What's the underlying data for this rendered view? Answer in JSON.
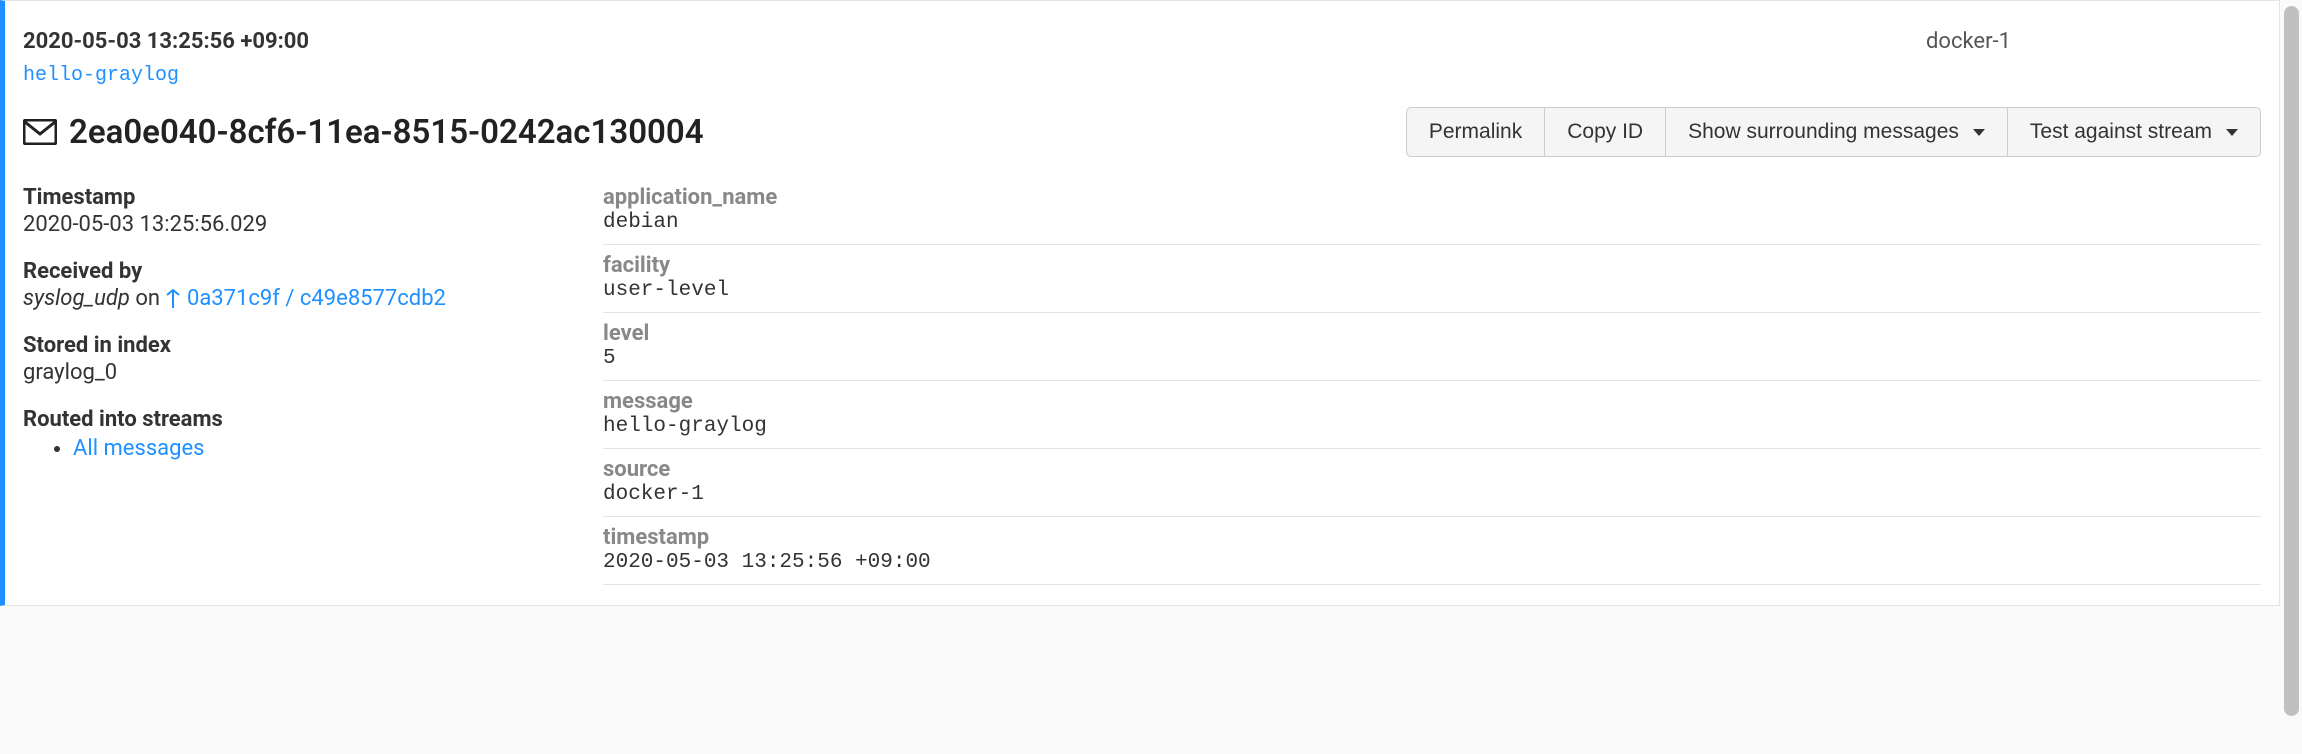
{
  "header": {
    "timestamp": "2020-05-03 13:25:56 +09:00",
    "source": "docker-1",
    "message_preview": "hello-graylog",
    "message_id": "2ea0e040-8cf6-11ea-8515-0242ac130004"
  },
  "buttons": {
    "permalink": "Permalink",
    "copy_id": "Copy ID",
    "surrounding": "Show surrounding messages",
    "test_stream": "Test against stream"
  },
  "meta": {
    "timestamp": {
      "label": "Timestamp",
      "value": "2020-05-03 13:25:56.029"
    },
    "received_by": {
      "label": "Received by",
      "input": "syslog_udp",
      "on": " on ",
      "node": "0a371c9f / c49e8577cdb2"
    },
    "stored_in": {
      "label": "Stored in index",
      "value": "graylog_0"
    },
    "routed": {
      "label": "Routed into streams",
      "streams": [
        "All messages"
      ]
    }
  },
  "fields": [
    {
      "name": "application_name",
      "value": "debian"
    },
    {
      "name": "facility",
      "value": "user-level"
    },
    {
      "name": "level",
      "value": "5"
    },
    {
      "name": "message",
      "value": "hello-graylog"
    },
    {
      "name": "source",
      "value": "docker-1"
    },
    {
      "name": "timestamp",
      "value": "2020-05-03 13:25:56 +09:00"
    }
  ]
}
